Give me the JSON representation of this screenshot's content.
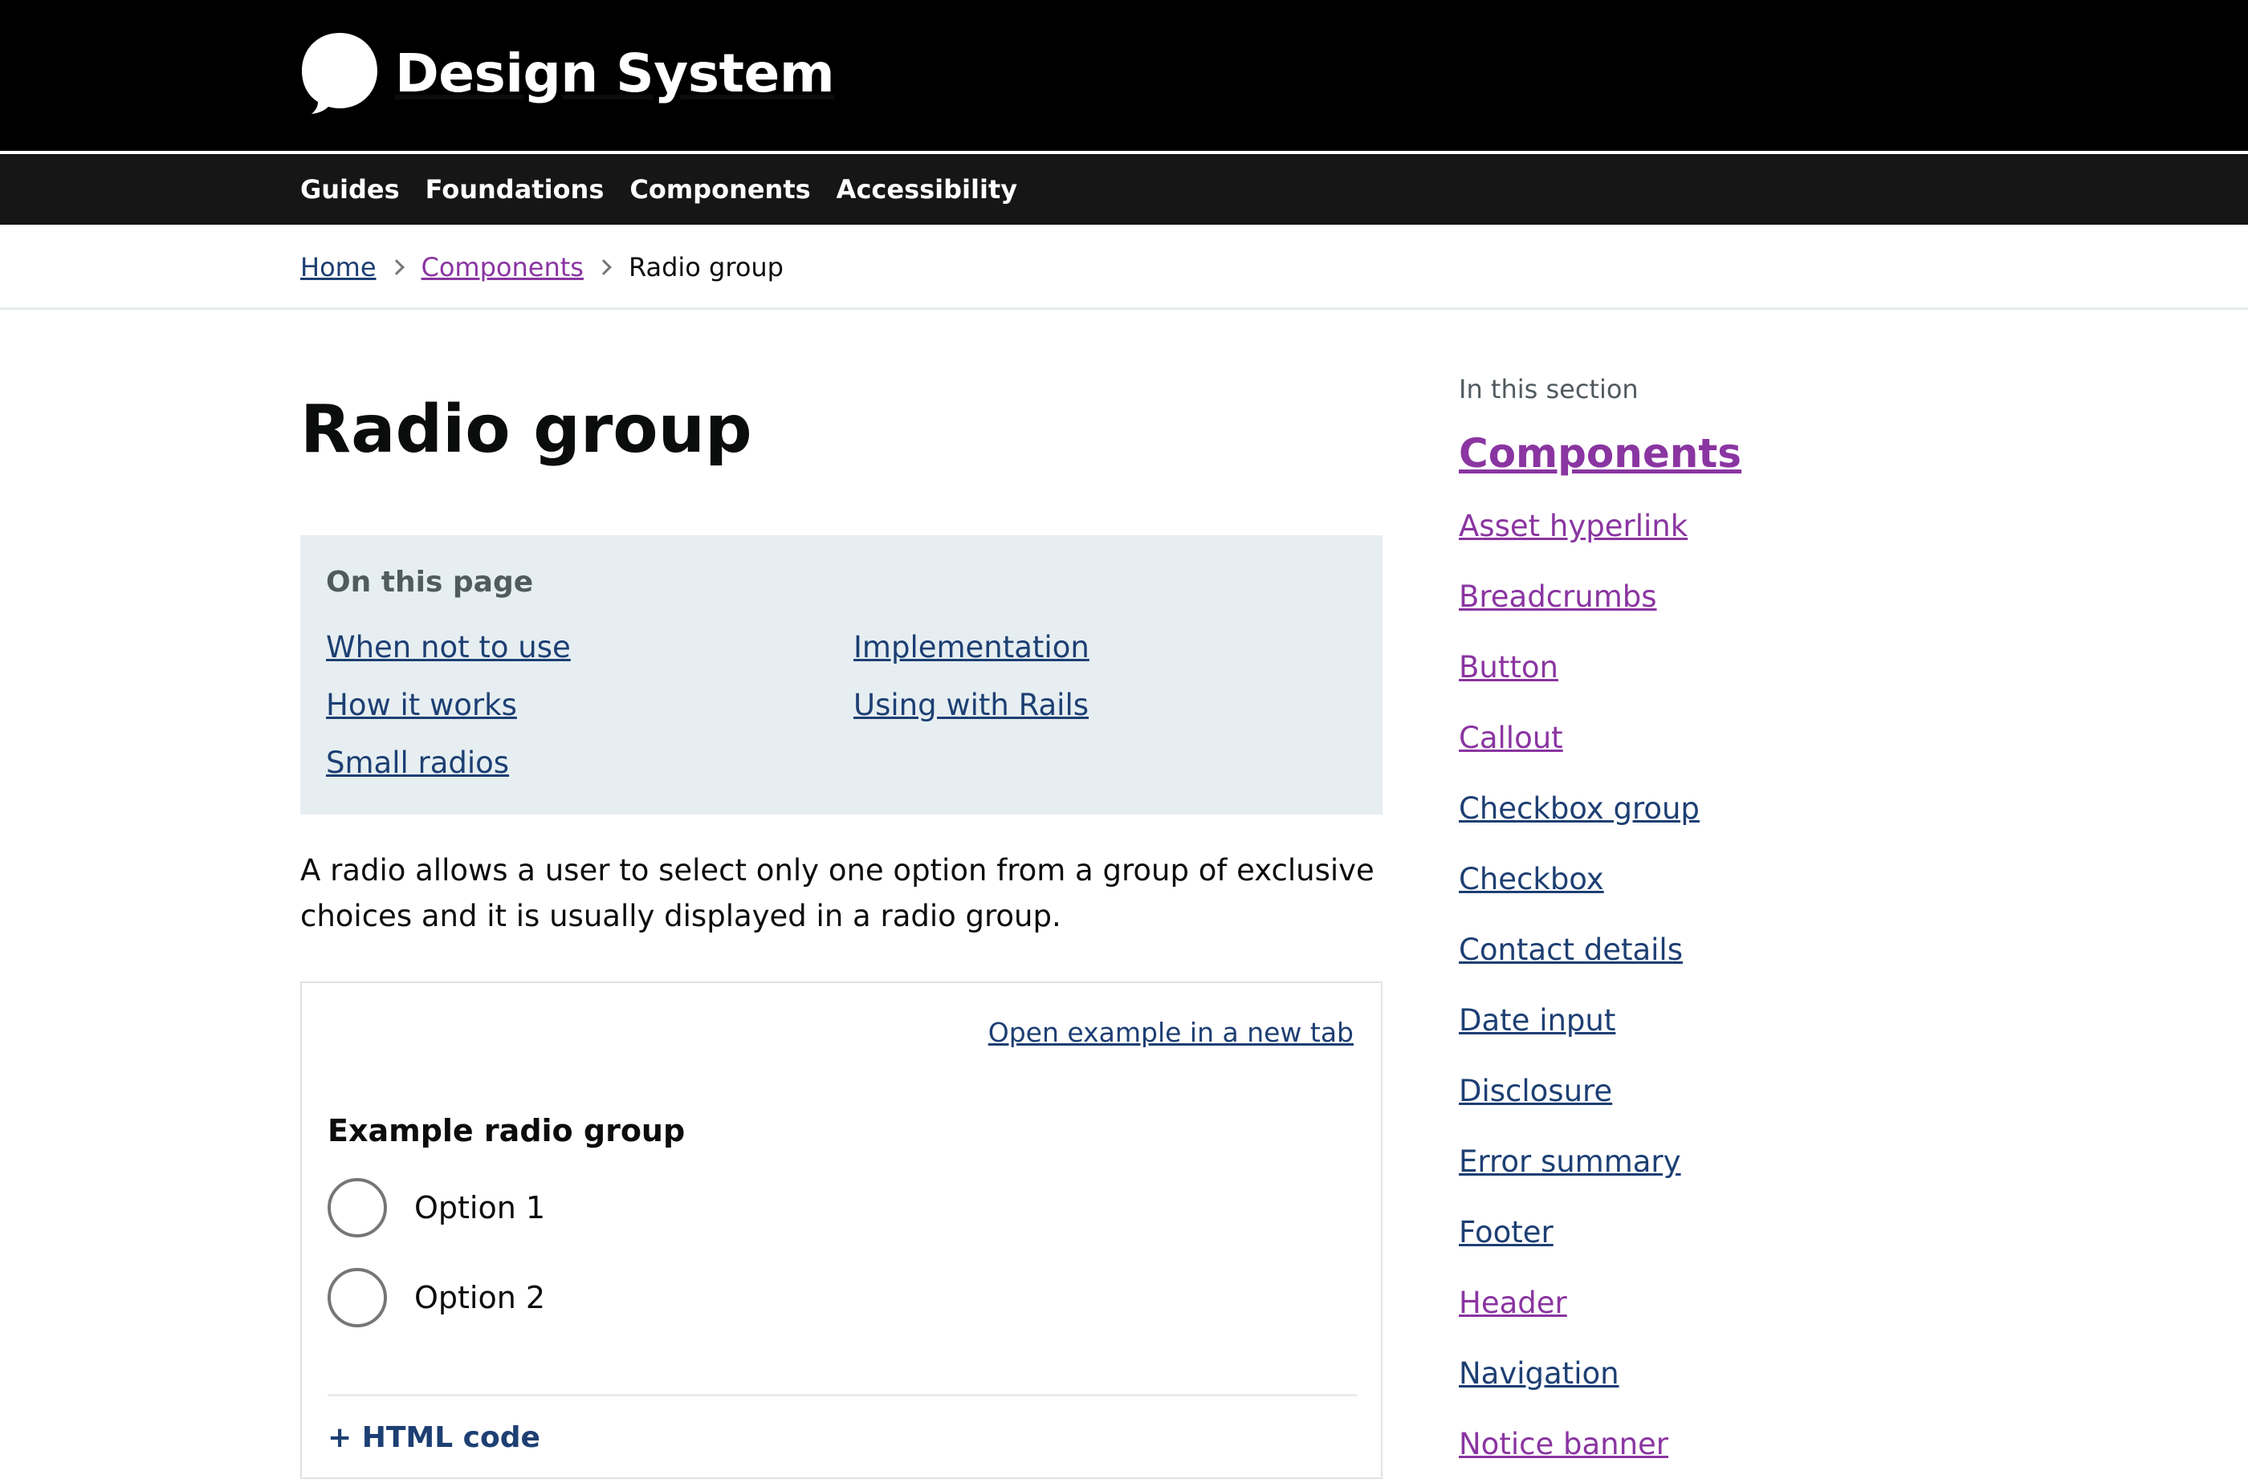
{
  "header": {
    "brand_name": "Design System"
  },
  "nav": {
    "items": [
      "Guides",
      "Foundations",
      "Components",
      "Accessibility"
    ]
  },
  "breadcrumb": {
    "home": "Home",
    "section": "Components",
    "current": "Radio group"
  },
  "page": {
    "title": "Radio group",
    "toc": {
      "heading": "On this page",
      "links": [
        "When not to use",
        "How it works",
        "Small radios",
        "Implementation",
        "Using with Rails"
      ]
    },
    "intro": "A radio allows a user to select only one option from a group of exclusive choices and it is usually displayed in a radio group."
  },
  "example": {
    "open_link": "Open example in a new tab",
    "legend": "Example radio group",
    "options": [
      "Option 1",
      "Option 2"
    ],
    "code_toggle": "+ HTML code"
  },
  "sidebar": {
    "caption": "In this section",
    "heading": "Components",
    "items": [
      "Asset hyperlink",
      "Breadcrumbs",
      "Button",
      "Callout",
      "Checkbox group",
      "Checkbox",
      "Contact details",
      "Date input",
      "Disclosure",
      "Error summary",
      "Footer",
      "Header",
      "Navigation",
      "Notice banner"
    ]
  },
  "colors": {
    "link": "#1d3f73",
    "visited_link": "#8a35a1",
    "header_bg": "#000000",
    "nav_bg": "#161616",
    "toc_bg": "#e6eef1"
  }
}
